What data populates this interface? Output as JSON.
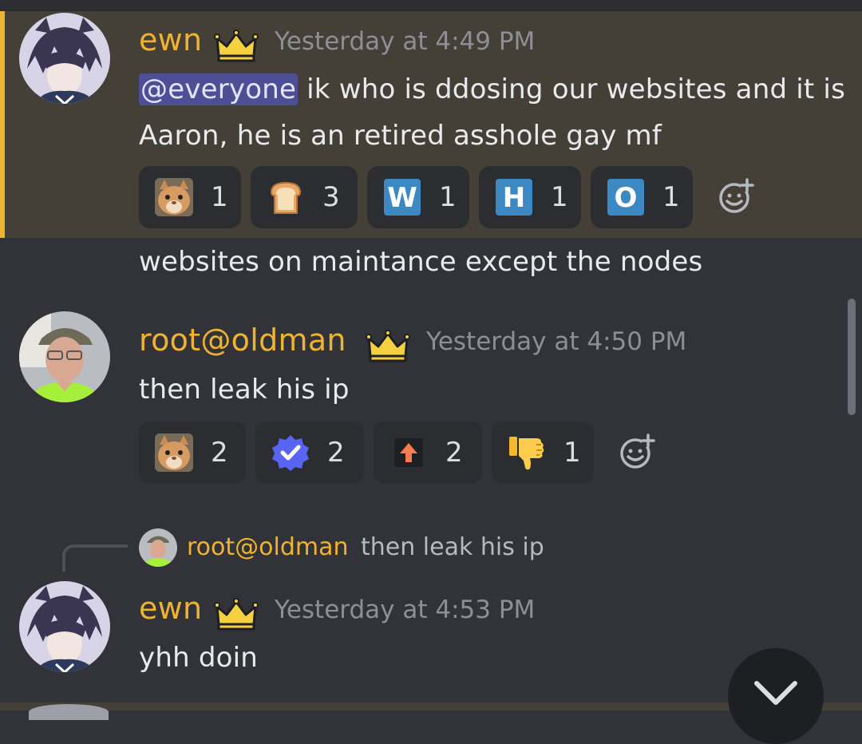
{
  "messages": [
    {
      "author": "ewn",
      "timestamp": "Yesterday at 4:49 PM",
      "mention": "@everyone",
      "line1_rest": " ik who is ddosing our websites and it is",
      "line2": "Aaron, he is an retired asshole gay mf",
      "reactions": [
        {
          "emoji": "cat-face-emoji",
          "count": "1"
        },
        {
          "emoji": "bread-emoji",
          "count": "3"
        },
        {
          "emoji": "letter-w-emoji",
          "glyph": "W",
          "count": "1"
        },
        {
          "emoji": "letter-h-emoji",
          "glyph": "H",
          "count": "1"
        },
        {
          "emoji": "letter-o-emoji",
          "glyph": "O",
          "count": "1"
        }
      ]
    },
    {
      "author": "ewn",
      "text": "websites on maintance except the nodes"
    },
    {
      "author": "root@oldman",
      "timestamp": "Yesterday at 4:50 PM",
      "text": "then leak his ip",
      "reactions": [
        {
          "emoji": "cat-face-emoji",
          "count": "2"
        },
        {
          "emoji": "verified-check-emoji",
          "count": "2"
        },
        {
          "emoji": "upvote-arrow-emoji",
          "count": "2"
        },
        {
          "emoji": "thumbs-down-emoji",
          "count": "1"
        }
      ]
    },
    {
      "author": "ewn",
      "timestamp": "Yesterday at 4:53 PM",
      "reply_to": {
        "author": "root@oldman",
        "text": "then leak his ip"
      },
      "text": "yhh doin"
    }
  ],
  "colors": {
    "background": "#313338",
    "mention_highlight": "#444037",
    "mention_bar": "#f0b232",
    "username": "#f0b232",
    "reaction_bg": "#2b2d31"
  }
}
